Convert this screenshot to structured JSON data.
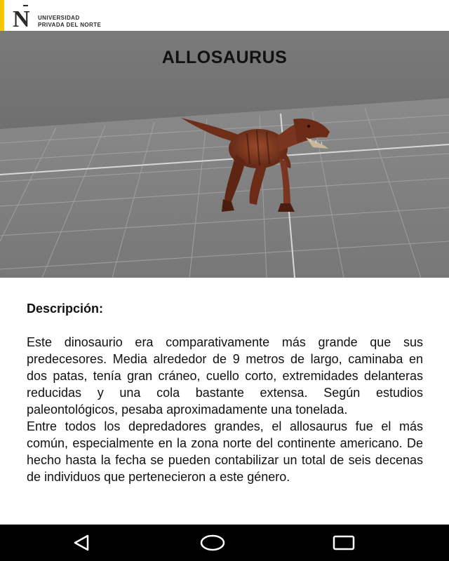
{
  "header": {
    "brand_line1": "UNIVERSIDAD",
    "brand_line2": "PRIVADA DEL NORTE",
    "accent_color": "#f7c600"
  },
  "viewer": {
    "title": "ALLOSAURUS"
  },
  "content": {
    "heading": "Descripción:",
    "paragraph1": "Este dinosaurio era comparativamente más grande que sus predecesores. Media alrededor de 9 metros de largo, caminaba en dos patas, tenía gran cráneo, cuello corto, extremidades delanteras reducidas y una cola bastante extensa. Según estudios paleontológicos, pesaba aproximadamente una tonelada.",
    "paragraph2": "Entre todos los depredadores grandes, el allosaurus fue el más común, especialmente en la zona norte del continente americano. De hecho hasta la fecha se pueden contabilizar un total de seis decenas de individuos que pertenecieron a este género."
  },
  "navbar": {
    "icons": [
      "back-triangle-icon",
      "home-circle-icon",
      "recents-square-icon"
    ]
  }
}
